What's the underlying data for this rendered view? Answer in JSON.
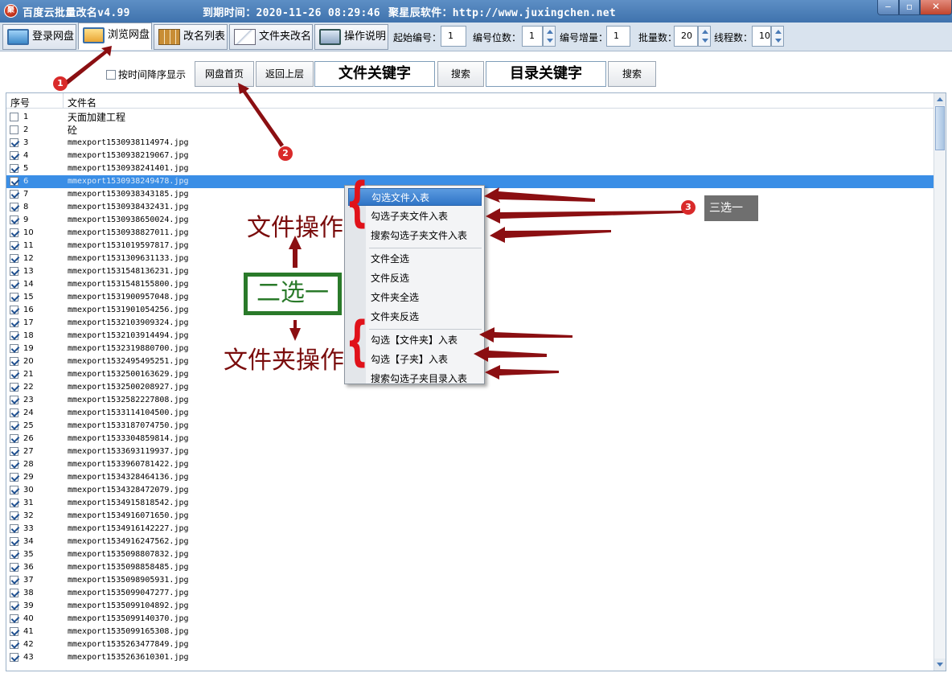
{
  "titlebar": {
    "logo": "聚",
    "app_title": "百度云批量改名v4.99",
    "expire": "到期时间：2020-11-26 08:29:46",
    "site": "聚星辰软件：http://www.juxingchen.net",
    "min_icon": "‒",
    "max_icon": "▫",
    "close_icon": "✕"
  },
  "tabs": [
    {
      "label": "登录网盘",
      "icon": "monitor-icon"
    },
    {
      "label": "浏览网盘",
      "icon": "monitor-icon",
      "active": true
    },
    {
      "label": "改名列表",
      "icon": "table-icon"
    },
    {
      "label": "文件夹改名",
      "icon": "mail-icon"
    },
    {
      "label": "操作说明",
      "icon": "help-icon"
    }
  ],
  "settings": {
    "start_no_label": "起始编号：",
    "start_no": "1",
    "digits_label": "编号位数：",
    "digits": "1",
    "increment_label": "编号增量：",
    "increment": "1",
    "batch_label": "批量数：",
    "batch": "20",
    "threads_label": "线程数：",
    "threads": "10"
  },
  "search": {
    "sort_desc_label": "按时间降序显示",
    "sort_desc_checked": false,
    "home_button": "网盘首页",
    "up_button": "返回上层",
    "file_keyword": "文件关键字",
    "file_search_button": "搜索",
    "dir_keyword": "目录关键字",
    "dir_search_button": "搜索"
  },
  "table": {
    "columns": [
      "序号",
      "文件名"
    ],
    "selected_row": 6,
    "rows": [
      {
        "no": "1",
        "name": "天面加建工程",
        "checked": false
      },
      {
        "no": "2",
        "name": "砼",
        "checked": false
      },
      {
        "no": "3",
        "name": "mmexport1530938114974.jpg",
        "checked": true
      },
      {
        "no": "4",
        "name": "mmexport1530938219067.jpg",
        "checked": true
      },
      {
        "no": "5",
        "name": "mmexport1530938241401.jpg",
        "checked": true
      },
      {
        "no": "6",
        "name": "mmexport1530938249478.jpg",
        "checked": true
      },
      {
        "no": "7",
        "name": "mmexport1530938343185.jpg",
        "checked": true
      },
      {
        "no": "8",
        "name": "mmexport1530938432431.jpg",
        "checked": true
      },
      {
        "no": "9",
        "name": "mmexport1530938650024.jpg",
        "checked": true
      },
      {
        "no": "10",
        "name": "mmexport1530938827011.jpg",
        "checked": true
      },
      {
        "no": "11",
        "name": "mmexport1531019597817.jpg",
        "checked": true
      },
      {
        "no": "12",
        "name": "mmexport1531309631133.jpg",
        "checked": true
      },
      {
        "no": "13",
        "name": "mmexport1531548136231.jpg",
        "checked": true
      },
      {
        "no": "14",
        "name": "mmexport1531548155800.jpg",
        "checked": true
      },
      {
        "no": "15",
        "name": "mmexport1531900957048.jpg",
        "checked": true
      },
      {
        "no": "16",
        "name": "mmexport1531901054256.jpg",
        "checked": true
      },
      {
        "no": "17",
        "name": "mmexport1532103909324.jpg",
        "checked": true
      },
      {
        "no": "18",
        "name": "mmexport1532103914494.jpg",
        "checked": true
      },
      {
        "no": "19",
        "name": "mmexport1532319880700.jpg",
        "checked": true
      },
      {
        "no": "20",
        "name": "mmexport1532495495251.jpg",
        "checked": true
      },
      {
        "no": "21",
        "name": "mmexport1532500163629.jpg",
        "checked": true
      },
      {
        "no": "22",
        "name": "mmexport1532500208927.jpg",
        "checked": true
      },
      {
        "no": "23",
        "name": "mmexport1532582227808.jpg",
        "checked": true
      },
      {
        "no": "24",
        "name": "mmexport1533114104500.jpg",
        "checked": true
      },
      {
        "no": "25",
        "name": "mmexport1533187074750.jpg",
        "checked": true
      },
      {
        "no": "26",
        "name": "mmexport1533304859814.jpg",
        "checked": true
      },
      {
        "no": "27",
        "name": "mmexport1533693119937.jpg",
        "checked": true
      },
      {
        "no": "28",
        "name": "mmexport1533960781422.jpg",
        "checked": true
      },
      {
        "no": "29",
        "name": "mmexport1534328464136.jpg",
        "checked": true
      },
      {
        "no": "30",
        "name": "mmexport1534328472079.jpg",
        "checked": true
      },
      {
        "no": "31",
        "name": "mmexport1534915818542.jpg",
        "checked": true
      },
      {
        "no": "32",
        "name": "mmexport1534916071650.jpg",
        "checked": true
      },
      {
        "no": "33",
        "name": "mmexport1534916142227.jpg",
        "checked": true
      },
      {
        "no": "34",
        "name": "mmexport1534916247562.jpg",
        "checked": true
      },
      {
        "no": "35",
        "name": "mmexport1535098807832.jpg",
        "checked": true
      },
      {
        "no": "36",
        "name": "mmexport1535098858485.jpg",
        "checked": true
      },
      {
        "no": "37",
        "name": "mmexport1535098905931.jpg",
        "checked": true
      },
      {
        "no": "38",
        "name": "mmexport1535099047277.jpg",
        "checked": true
      },
      {
        "no": "39",
        "name": "mmexport1535099104892.jpg",
        "checked": true
      },
      {
        "no": "40",
        "name": "mmexport1535099140370.jpg",
        "checked": true
      },
      {
        "no": "41",
        "name": "mmexport1535099165308.jpg",
        "checked": true
      },
      {
        "no": "42",
        "name": "mmexport1535263477849.jpg",
        "checked": true
      },
      {
        "no": "43",
        "name": "mmexport1535263610301.jpg",
        "checked": true
      }
    ]
  },
  "context_menu": {
    "items": [
      {
        "label": "勾选文件入表",
        "highlighted": true
      },
      {
        "label": "勾选子夹文件入表"
      },
      {
        "label": "搜索勾选子夹文件入表"
      },
      {
        "separator": true
      },
      {
        "label": "文件全选"
      },
      {
        "label": "文件反选"
      },
      {
        "label": "文件夹全选"
      },
      {
        "label": "文件夹反选"
      },
      {
        "separator": true
      },
      {
        "label": "勾选【文件夹】入表"
      },
      {
        "label": "勾选【子夹】入表"
      },
      {
        "label": "搜索勾选子夹目录入表"
      }
    ]
  },
  "annotations": {
    "step1": "1",
    "step2": "2",
    "step3": "3",
    "file_ops": "文件操作",
    "folder_ops": "文件夹操作",
    "choose_one_of_two": "二选一",
    "choose_one_of_three": "三选一",
    "brace_glyph": "{",
    "accent_color": "#7a0c0c",
    "badge_color": "#d92a2a",
    "green_color": "#2a7a2a"
  }
}
